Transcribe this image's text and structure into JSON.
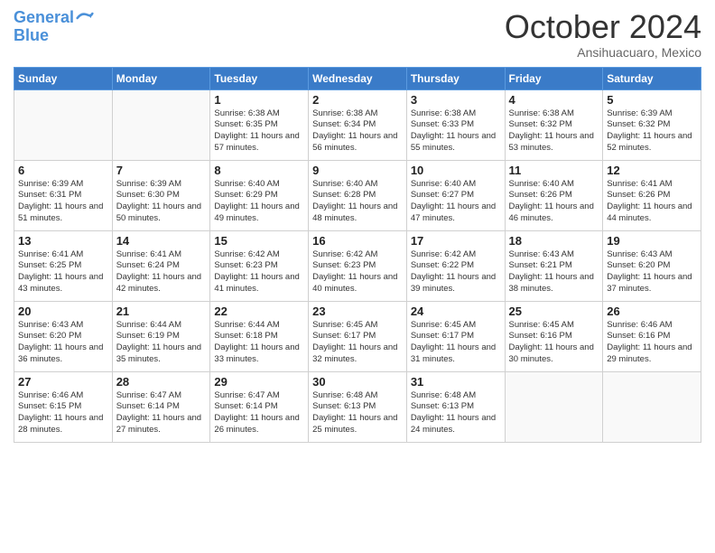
{
  "header": {
    "logo_line1": "General",
    "logo_line2": "Blue",
    "month": "October 2024",
    "location": "Ansihuacuaro, Mexico"
  },
  "weekdays": [
    "Sunday",
    "Monday",
    "Tuesday",
    "Wednesday",
    "Thursday",
    "Friday",
    "Saturday"
  ],
  "weeks": [
    [
      {
        "day": "",
        "info": ""
      },
      {
        "day": "",
        "info": ""
      },
      {
        "day": "1",
        "info": "Sunrise: 6:38 AM\nSunset: 6:35 PM\nDaylight: 11 hours and 57 minutes."
      },
      {
        "day": "2",
        "info": "Sunrise: 6:38 AM\nSunset: 6:34 PM\nDaylight: 11 hours and 56 minutes."
      },
      {
        "day": "3",
        "info": "Sunrise: 6:38 AM\nSunset: 6:33 PM\nDaylight: 11 hours and 55 minutes."
      },
      {
        "day": "4",
        "info": "Sunrise: 6:38 AM\nSunset: 6:32 PM\nDaylight: 11 hours and 53 minutes."
      },
      {
        "day": "5",
        "info": "Sunrise: 6:39 AM\nSunset: 6:32 PM\nDaylight: 11 hours and 52 minutes."
      }
    ],
    [
      {
        "day": "6",
        "info": "Sunrise: 6:39 AM\nSunset: 6:31 PM\nDaylight: 11 hours and 51 minutes."
      },
      {
        "day": "7",
        "info": "Sunrise: 6:39 AM\nSunset: 6:30 PM\nDaylight: 11 hours and 50 minutes."
      },
      {
        "day": "8",
        "info": "Sunrise: 6:40 AM\nSunset: 6:29 PM\nDaylight: 11 hours and 49 minutes."
      },
      {
        "day": "9",
        "info": "Sunrise: 6:40 AM\nSunset: 6:28 PM\nDaylight: 11 hours and 48 minutes."
      },
      {
        "day": "10",
        "info": "Sunrise: 6:40 AM\nSunset: 6:27 PM\nDaylight: 11 hours and 47 minutes."
      },
      {
        "day": "11",
        "info": "Sunrise: 6:40 AM\nSunset: 6:26 PM\nDaylight: 11 hours and 46 minutes."
      },
      {
        "day": "12",
        "info": "Sunrise: 6:41 AM\nSunset: 6:26 PM\nDaylight: 11 hours and 44 minutes."
      }
    ],
    [
      {
        "day": "13",
        "info": "Sunrise: 6:41 AM\nSunset: 6:25 PM\nDaylight: 11 hours and 43 minutes."
      },
      {
        "day": "14",
        "info": "Sunrise: 6:41 AM\nSunset: 6:24 PM\nDaylight: 11 hours and 42 minutes."
      },
      {
        "day": "15",
        "info": "Sunrise: 6:42 AM\nSunset: 6:23 PM\nDaylight: 11 hours and 41 minutes."
      },
      {
        "day": "16",
        "info": "Sunrise: 6:42 AM\nSunset: 6:23 PM\nDaylight: 11 hours and 40 minutes."
      },
      {
        "day": "17",
        "info": "Sunrise: 6:42 AM\nSunset: 6:22 PM\nDaylight: 11 hours and 39 minutes."
      },
      {
        "day": "18",
        "info": "Sunrise: 6:43 AM\nSunset: 6:21 PM\nDaylight: 11 hours and 38 minutes."
      },
      {
        "day": "19",
        "info": "Sunrise: 6:43 AM\nSunset: 6:20 PM\nDaylight: 11 hours and 37 minutes."
      }
    ],
    [
      {
        "day": "20",
        "info": "Sunrise: 6:43 AM\nSunset: 6:20 PM\nDaylight: 11 hours and 36 minutes."
      },
      {
        "day": "21",
        "info": "Sunrise: 6:44 AM\nSunset: 6:19 PM\nDaylight: 11 hours and 35 minutes."
      },
      {
        "day": "22",
        "info": "Sunrise: 6:44 AM\nSunset: 6:18 PM\nDaylight: 11 hours and 33 minutes."
      },
      {
        "day": "23",
        "info": "Sunrise: 6:45 AM\nSunset: 6:17 PM\nDaylight: 11 hours and 32 minutes."
      },
      {
        "day": "24",
        "info": "Sunrise: 6:45 AM\nSunset: 6:17 PM\nDaylight: 11 hours and 31 minutes."
      },
      {
        "day": "25",
        "info": "Sunrise: 6:45 AM\nSunset: 6:16 PM\nDaylight: 11 hours and 30 minutes."
      },
      {
        "day": "26",
        "info": "Sunrise: 6:46 AM\nSunset: 6:16 PM\nDaylight: 11 hours and 29 minutes."
      }
    ],
    [
      {
        "day": "27",
        "info": "Sunrise: 6:46 AM\nSunset: 6:15 PM\nDaylight: 11 hours and 28 minutes."
      },
      {
        "day": "28",
        "info": "Sunrise: 6:47 AM\nSunset: 6:14 PM\nDaylight: 11 hours and 27 minutes."
      },
      {
        "day": "29",
        "info": "Sunrise: 6:47 AM\nSunset: 6:14 PM\nDaylight: 11 hours and 26 minutes."
      },
      {
        "day": "30",
        "info": "Sunrise: 6:48 AM\nSunset: 6:13 PM\nDaylight: 11 hours and 25 minutes."
      },
      {
        "day": "31",
        "info": "Sunrise: 6:48 AM\nSunset: 6:13 PM\nDaylight: 11 hours and 24 minutes."
      },
      {
        "day": "",
        "info": ""
      },
      {
        "day": "",
        "info": ""
      }
    ]
  ]
}
